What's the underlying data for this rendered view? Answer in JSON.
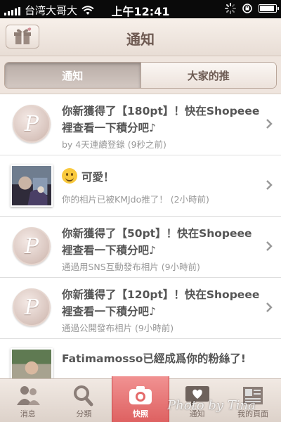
{
  "status_bar": {
    "carrier": "台湾大哥大",
    "time": "上午12:41",
    "icons": [
      "signal-icon",
      "wifi-icon",
      "activity-spinner-icon",
      "lock-rotation-icon",
      "battery-icon"
    ],
    "battery_level": 0.85
  },
  "header": {
    "title": "通知",
    "left_icon": "gift-icon"
  },
  "tabs": [
    {
      "label": "通知",
      "active": true
    },
    {
      "label": "大家的推",
      "active": false
    }
  ],
  "notifications": [
    {
      "type": "points",
      "avatar": "P",
      "message": "你新獲得了【180pt】！快在Shopeee裡查看一下積分吧♪",
      "detail": "by 4天連續登錄 (9秒之前)"
    },
    {
      "type": "like",
      "avatar": "photo",
      "message": "可愛！",
      "detail": "你的相片已被KMJdo推了！ (2小時前)"
    },
    {
      "type": "points",
      "avatar": "P",
      "message": "你新獲得了【50pt】！快在Shopeee裡查看一下積分吧♪",
      "detail": "通過用SNS互動發布相片 (9小時前)"
    },
    {
      "type": "points",
      "avatar": "P",
      "message": "你新獲得了【120pt】！快在Shopeee裡查看一下積分吧♪",
      "detail": "通過公開發布相片 (9小時前)"
    },
    {
      "type": "follow",
      "avatar": "photo",
      "message": "Fatimamosso已經成爲你的粉絲了!",
      "detail": ""
    }
  ],
  "tab_bar": [
    {
      "label": "消息",
      "icon": "people-icon"
    },
    {
      "label": "分類",
      "icon": "search-icon"
    },
    {
      "label": "快照",
      "icon": "camera-icon"
    },
    {
      "label": "通知",
      "icon": "heart-bubble-icon"
    },
    {
      "label": "我的頁面",
      "icon": "profile-card-icon"
    }
  ],
  "watermark": "Photo by Tina",
  "colors": {
    "accent_camera": "#e46a6a",
    "header_title": "#6e5a52",
    "text_main": "#555555",
    "text_sub": "#999999"
  }
}
